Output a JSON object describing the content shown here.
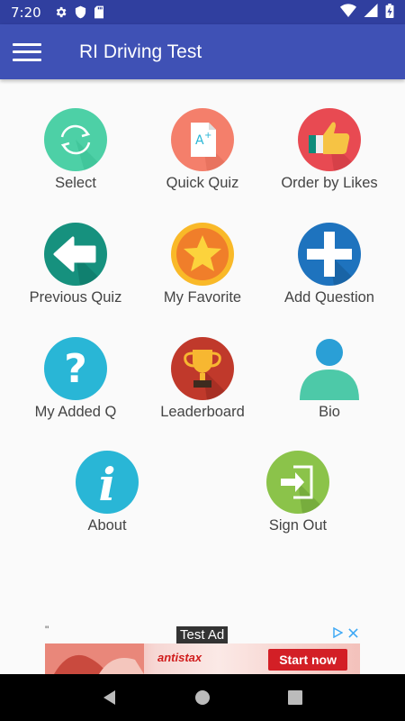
{
  "status_bar": {
    "time": "7:20",
    "left_icons": [
      "gear-icon",
      "shield-icon",
      "sd-card-icon"
    ],
    "right_icons": [
      "wifi-icon",
      "signal-icon",
      "battery-icon"
    ]
  },
  "app_bar": {
    "title": "RI Driving Test",
    "menu_icon": "hamburger-menu-icon"
  },
  "tiles": [
    {
      "label": "Select",
      "icon": "sync-icon",
      "color": "#4dd0a6"
    },
    {
      "label": "Quick Quiz",
      "icon": "graded-paper-icon",
      "color": "#f47f6b"
    },
    {
      "label": "Order by Likes",
      "icon": "thumbs-up-icon",
      "color": "#e84a52"
    },
    {
      "label": "Previous Quiz",
      "icon": "arrow-left-icon",
      "color": "#16917e"
    },
    {
      "label": "My Favorite",
      "icon": "star-icon",
      "color": "#f9b928"
    },
    {
      "label": "Add Question",
      "icon": "plus-icon",
      "color": "#1e73be"
    },
    {
      "label": "My Added Q",
      "icon": "question-mark-icon",
      "color": "#29b6d6"
    },
    {
      "label": "Leaderboard",
      "icon": "trophy-icon",
      "color": "#c0392b"
    },
    {
      "label": "Bio",
      "icon": "person-icon",
      "color": "#2a9fd6"
    },
    {
      "label": "About",
      "icon": "info-icon",
      "color": "#29b6d6"
    },
    {
      "label": "Sign Out",
      "icon": "sign-out-icon",
      "color": "#8bc34a"
    }
  ],
  "ad": {
    "quote": "\"",
    "badge": "Test Ad",
    "brand": "antistax",
    "cta": "Start now",
    "icons": [
      "ad-choices-icon",
      "close-icon"
    ]
  },
  "nav_bar": {
    "buttons": [
      "back-icon",
      "home-icon",
      "recents-icon"
    ]
  },
  "colors": {
    "status_bar": "#303f9f",
    "app_bar": "#3f51b5",
    "background": "#fafafa",
    "label_text": "#444444"
  }
}
